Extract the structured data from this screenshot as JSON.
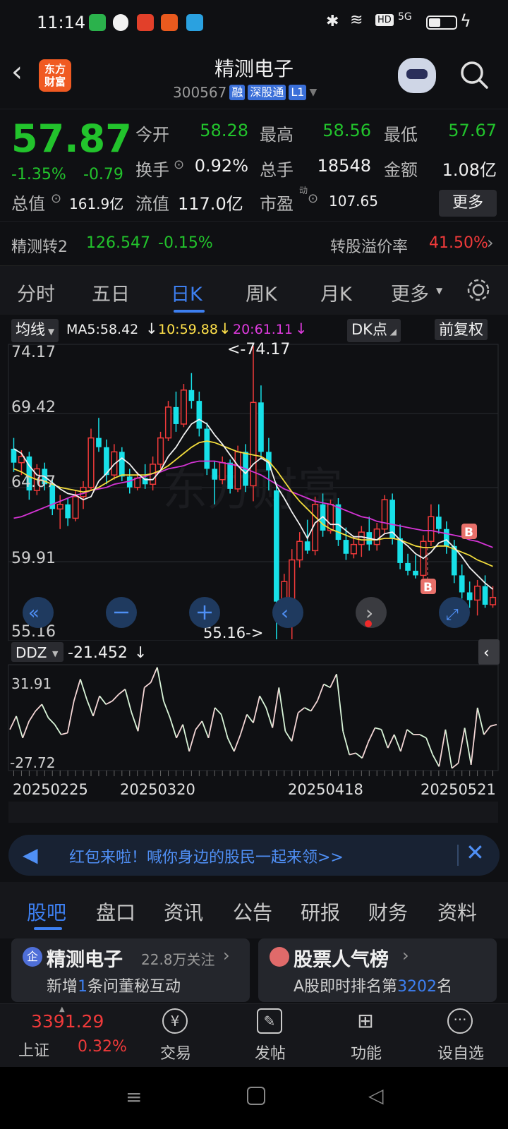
{
  "status_bar": {
    "time": "11:14",
    "battery_icon": "battery-icon",
    "signal": "5G"
  },
  "header": {
    "back_icon": "chevron-left-icon",
    "logo_text_1": "东方",
    "logo_text_2": "财富",
    "stock_name": "精测电子",
    "stock_code": "300567",
    "tags": [
      "融",
      "深股通",
      "L1"
    ]
  },
  "quote": {
    "price": "57.87",
    "change_pct": "-1.35%",
    "change_val": "-0.79",
    "open_label": "今开",
    "open": "58.28",
    "high_label": "最高",
    "high": "58.56",
    "low_label": "最低",
    "low": "57.67",
    "turnover_label": "换手",
    "turnover": "0.92%",
    "volume_label": "总手",
    "volume": "18548",
    "amount_label": "金额",
    "amount": "1.08亿",
    "total_cap_label": "总值",
    "total_cap": "161.9亿",
    "float_cap_label": "流值",
    "float_cap": "117.0亿",
    "pe_label": "市盈",
    "pe_sup": "动",
    "pe": "107.65",
    "more_button": "更多"
  },
  "convertible": {
    "name": "精测转2",
    "price": "126.547",
    "change": "-0.15%",
    "premium_label": "转股溢价率",
    "premium": "41.50%"
  },
  "period_tabs": [
    "分时",
    "五日",
    "日K",
    "周K",
    "月K",
    "更多"
  ],
  "period_active": "日K",
  "kline": {
    "ma_selector": "均线",
    "ma5": "MA5:58.42",
    "ma10": "10:59.88",
    "ma20": "20:61.11",
    "dk_button": "DK点",
    "adjust_button": "前复权",
    "y_labels": [
      "74.17",
      "69.42",
      "64.67",
      "59.91",
      "55.16"
    ],
    "max_marker": "<-74.17",
    "min_marker": "55.16->",
    "buy_marker": "B"
  },
  "ddz": {
    "selector": "DDZ",
    "value": "-21.452",
    "y_labels": [
      "31.91",
      "-27.72"
    ],
    "dates": [
      "20250225",
      "20250320",
      "20250418",
      "20250521"
    ]
  },
  "banner": {
    "text": "红包来啦！喊你身边的股民一起来领>>"
  },
  "content_tabs": [
    "股吧",
    "盘口",
    "资讯",
    "公告",
    "研报",
    "财务",
    "资料"
  ],
  "content_active": "股吧",
  "cards": [
    {
      "badge": "企",
      "title": "精测电子",
      "follow": "22.8万关注",
      "sub_1": "新增",
      "sub_num": "1",
      "sub_2": "条问董秘互动"
    },
    {
      "title": "股票人气榜",
      "sub_1": "A股即时排名第",
      "sub_num": "3202",
      "sub_2": "名"
    }
  ],
  "bottom_bar": {
    "index_value": "3391.29",
    "index_name": "上证",
    "index_change": "0.32%",
    "items": [
      "交易",
      "发帖",
      "功能",
      "设自选"
    ]
  },
  "chart_data": [
    {
      "type": "candlestick",
      "title": "日K",
      "ylim": [
        55.16,
        74.17
      ],
      "series_names": [
        "MA5",
        "MA10",
        "MA20"
      ],
      "ohlc": [
        [
          67.5,
          68.2,
          66.0,
          66.6
        ],
        [
          66.6,
          67.4,
          65.8,
          67.0
        ],
        [
          67.0,
          67.3,
          64.2,
          64.8
        ],
        [
          64.8,
          66.5,
          64.5,
          66.2
        ],
        [
          66.2,
          66.6,
          64.8,
          65.2
        ],
        [
          65.2,
          65.6,
          63.2,
          63.6
        ],
        [
          63.6,
          64.5,
          62.3,
          63.9
        ],
        [
          63.9,
          64.3,
          62.5,
          63.0
        ],
        [
          63.0,
          64.8,
          62.8,
          64.4
        ],
        [
          64.4,
          65.4,
          63.6,
          65.0
        ],
        [
          65.0,
          68.8,
          64.8,
          68.2
        ],
        [
          68.2,
          69.5,
          67.3,
          67.6
        ],
        [
          67.6,
          68.1,
          65.2,
          65.8
        ],
        [
          65.8,
          67.8,
          65.5,
          67.3
        ],
        [
          67.3,
          67.6,
          65.4,
          65.7
        ],
        [
          65.7,
          66.2,
          64.6,
          65.0
        ],
        [
          65.0,
          66.0,
          64.8,
          65.6
        ],
        [
          65.6,
          66.5,
          64.9,
          65.2
        ],
        [
          65.2,
          67.0,
          64.8,
          66.5
        ],
        [
          66.5,
          68.6,
          66.2,
          68.2
        ],
        [
          68.2,
          70.6,
          68.0,
          70.2
        ],
        [
          70.2,
          71.2,
          68.6,
          69.1
        ],
        [
          69.1,
          71.7,
          68.9,
          71.3
        ],
        [
          71.3,
          72.4,
          70.1,
          70.6
        ],
        [
          70.6,
          71.2,
          68.3,
          68.8
        ],
        [
          68.8,
          69.2,
          65.8,
          66.2
        ],
        [
          66.2,
          66.7,
          63.9,
          65.5
        ],
        [
          65.5,
          67.0,
          65.2,
          66.6
        ],
        [
          66.6,
          66.8,
          64.6,
          64.9
        ],
        [
          64.9,
          67.7,
          64.7,
          67.3
        ],
        [
          67.3,
          67.8,
          64.7,
          65.1
        ],
        [
          65.1,
          74.17,
          64.1,
          70.5
        ],
        [
          70.5,
          71.6,
          66.8,
          67.3
        ],
        [
          67.3,
          68.2,
          64.8,
          66.1
        ],
        [
          64.8,
          65.3,
          55.16,
          57.6
        ],
        [
          57.6,
          59.4,
          56.3,
          58.9
        ],
        [
          57.0,
          61.0,
          55.16,
          60.3
        ],
        [
          60.3,
          62.1,
          59.8,
          61.5
        ],
        [
          61.5,
          62.9,
          60.7,
          60.9
        ],
        [
          60.9,
          64.4,
          60.6,
          63.9
        ],
        [
          63.9,
          64.6,
          61.8,
          62.2
        ],
        [
          62.2,
          64.2,
          62.0,
          63.9
        ],
        [
          63.9,
          64.3,
          61.2,
          61.6
        ],
        [
          61.6,
          62.4,
          60.3,
          60.7
        ],
        [
          60.7,
          61.8,
          60.4,
          61.3
        ],
        [
          61.3,
          62.5,
          60.5,
          62.1
        ],
        [
          62.1,
          63.1,
          60.9,
          61.3
        ],
        [
          61.3,
          62.7,
          60.9,
          62.3
        ],
        [
          62.3,
          64.5,
          62.0,
          64.2
        ],
        [
          64.2,
          64.6,
          61.3,
          61.7
        ],
        [
          61.7,
          62.6,
          59.7,
          60.1
        ],
        [
          60.1,
          60.7,
          59.3,
          59.6
        ],
        [
          59.6,
          60.6,
          59.1,
          59.3
        ],
        [
          59.3,
          61.9,
          59.1,
          61.5
        ],
        [
          61.5,
          63.9,
          61.2,
          63.1
        ],
        [
          63.1,
          63.9,
          62.0,
          62.3
        ],
        [
          62.3,
          62.8,
          60.7,
          61.2
        ],
        [
          61.2,
          61.6,
          58.8,
          59.3
        ],
        [
          59.3,
          60.0,
          57.8,
          58.2
        ],
        [
          58.2,
          58.9,
          57.2,
          57.7
        ],
        [
          57.7,
          59.0,
          56.7,
          58.6
        ],
        [
          58.6,
          59.3,
          57.2,
          57.4
        ],
        [
          57.4,
          58.6,
          57.2,
          57.87
        ]
      ],
      "ma5": [
        67.5,
        67.2,
        66.4,
        65.8,
        65.7,
        65.3,
        64.9,
        64.6,
        64.5,
        64.2,
        64.4,
        65.4,
        65.9,
        66.5,
        66.9,
        66.5,
        65.9,
        65.5,
        65.5,
        66.1,
        67.0,
        67.6,
        68.4,
        69.1,
        69.4,
        69.1,
        68.4,
        67.8,
        67.1,
        66.4,
        65.9,
        66.5,
        66.9,
        66.6,
        65.1,
        64.3,
        63.4,
        62.6,
        61.7,
        62.7,
        63.1,
        62.6,
        62.6,
        62.2,
        61.8,
        61.8,
        61.7,
        61.6,
        62.0,
        62.1,
        61.6,
        61.2,
        60.7,
        60.4,
        60.8,
        61.4,
        61.6,
        61.1,
        60.5,
        59.8,
        59.3,
        58.8,
        58.4
      ],
      "ma10": [
        66.2,
        66.0,
        65.7,
        65.5,
        65.4,
        65.2,
        65.0,
        64.9,
        64.8,
        64.7,
        64.8,
        65.0,
        65.3,
        65.6,
        65.8,
        65.8,
        65.8,
        65.8,
        65.9,
        66.1,
        66.4,
        66.8,
        67.2,
        67.6,
        67.9,
        68.0,
        67.9,
        67.7,
        67.5,
        67.3,
        67.2,
        67.1,
        67.0,
        66.7,
        66.1,
        65.4,
        64.7,
        64.1,
        63.6,
        63.1,
        62.6,
        62.3,
        62.1,
        61.9,
        61.7,
        61.6,
        61.6,
        61.6,
        61.7,
        61.7,
        61.6,
        61.4,
        61.2,
        61.1,
        61.1,
        61.2,
        61.2,
        61.0,
        60.8,
        60.6,
        60.3,
        60.1,
        59.88
      ],
      "ma20": [
        63.0,
        63.1,
        63.3,
        63.5,
        63.7,
        63.9,
        64.1,
        64.3,
        64.5,
        64.6,
        64.8,
        64.9,
        65.0,
        65.2,
        65.3,
        65.4,
        65.6,
        65.7,
        65.9,
        66.0,
        66.2,
        66.3,
        66.4,
        66.6,
        66.7,
        66.7,
        66.7,
        66.6,
        66.5,
        66.4,
        66.2,
        66.0,
        65.8,
        65.5,
        65.2,
        64.9,
        64.7,
        64.5,
        64.3,
        64.1,
        64.0,
        63.9,
        63.7,
        63.5,
        63.3,
        63.1,
        63.0,
        62.8,
        62.7,
        62.6,
        62.5,
        62.4,
        62.3,
        62.2,
        62.2,
        62.1,
        62.0,
        61.9,
        61.8,
        61.6,
        61.5,
        61.3,
        61.11
      ]
    },
    {
      "type": "line",
      "title": "DDZ",
      "ylim": [
        -27.72,
        31.91
      ],
      "x": [
        "20250225",
        "20250320",
        "20250418",
        "20250521"
      ],
      "values": [
        -5,
        3,
        -10,
        0,
        6,
        10,
        2,
        -2,
        -8,
        -7,
        12,
        25,
        13,
        3,
        15,
        10,
        12,
        16,
        19,
        5,
        -6,
        20,
        23,
        32,
        12,
        2,
        -10,
        -2,
        -18,
        -5,
        0,
        -10,
        8,
        4,
        -10,
        -18,
        -8,
        4,
        -1,
        15,
        8,
        -4,
        20,
        -6,
        -12,
        5,
        8,
        6,
        12,
        22,
        20,
        28,
        -6,
        -20,
        -19,
        -22,
        -12,
        -4,
        -5,
        -16,
        -8,
        -18,
        -5,
        -8,
        -8,
        -10,
        -20,
        -27,
        -5,
        -28,
        -25,
        -4,
        -26,
        8,
        -8,
        -3,
        -2
      ]
    }
  ]
}
